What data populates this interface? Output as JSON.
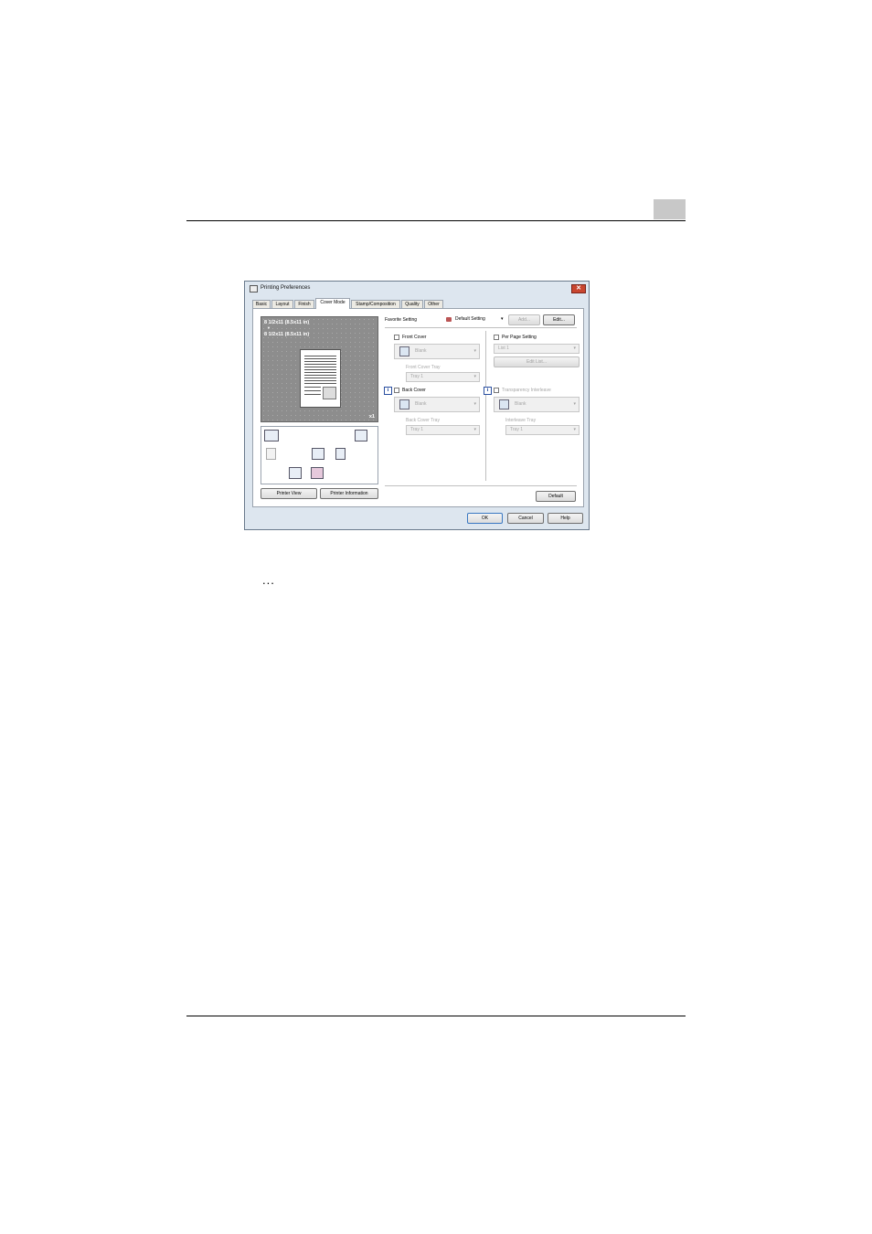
{
  "window": {
    "title": "Printing Preferences"
  },
  "tabs": [
    "Basic",
    "Layout",
    "Finish",
    "Cover Mode",
    "Stamp/Composition",
    "Quality",
    "Other"
  ],
  "preview": {
    "line1": "8 1/2x11 (8.5x11 in)",
    "arrow": "▼",
    "line2": "8 1/2x11 (8.5x11 in)",
    "copies": "x1"
  },
  "left_buttons": {
    "printer_view": "Printer View",
    "printer_information": "Printer Information"
  },
  "favorite": {
    "label": "Favorite Setting",
    "value": "Default Setting",
    "add": "Add...",
    "edit": "Edit..."
  },
  "front_cover": {
    "label": "Front Cover",
    "value": "Blank",
    "tray_label": "Front Cover Tray",
    "tray_value": "Tray 1"
  },
  "back_cover": {
    "label": "Back Cover",
    "value": "Blank",
    "tray_label": "Back Cover Tray",
    "tray_value": "Tray 1"
  },
  "per_page": {
    "label": "Per Page Setting",
    "value": "List 1",
    "edit_list": "Edit List..."
  },
  "transparency": {
    "label": "Transparency Interleave",
    "value": "Blank",
    "tray_label": "Interleave Tray",
    "tray_value": "Tray 1"
  },
  "default_button": "Default",
  "footer_buttons": {
    "ok": "OK",
    "cancel": "Cancel",
    "help": "Help"
  },
  "close_glyph": "✕",
  "info_glyph": "i",
  "dropdown_arrow": "▾",
  "ellipsis": "..."
}
